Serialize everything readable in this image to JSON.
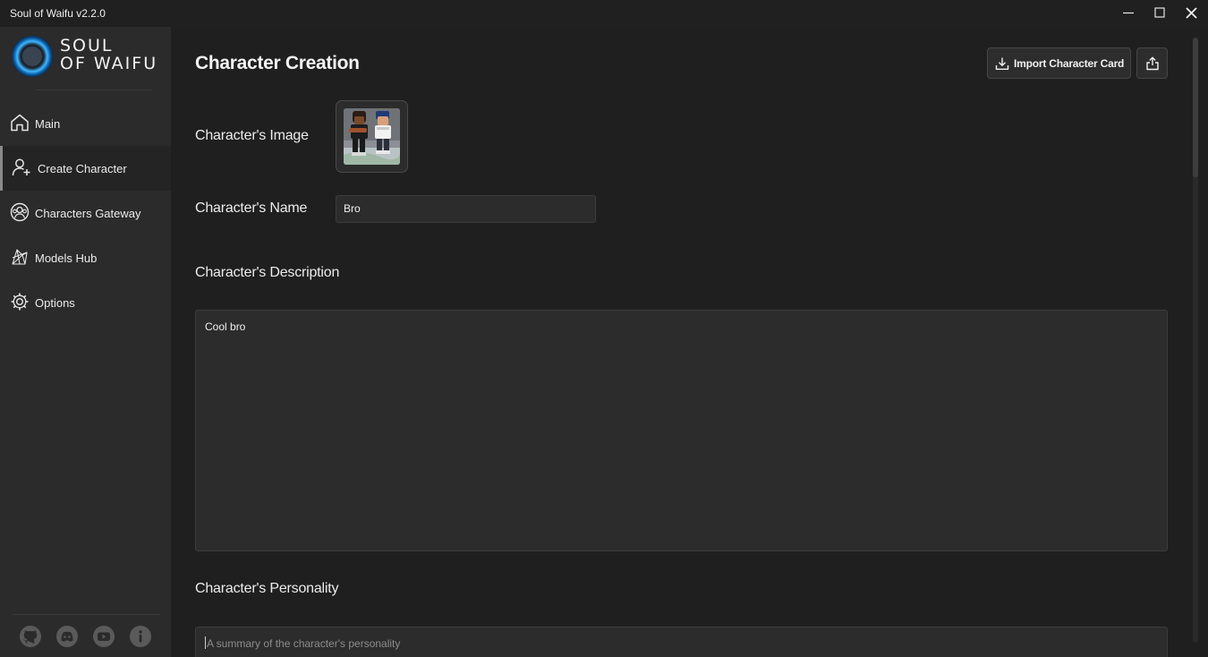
{
  "window": {
    "title": "Soul of Waifu v2.2.0",
    "controls": [
      "minimize-icon",
      "maximize-icon",
      "close-icon"
    ]
  },
  "sidebar": {
    "logo_line1": "SOUL",
    "logo_line2": "OF WAIFU",
    "items": [
      {
        "label": "Main",
        "icon": "home-icon",
        "active": false
      },
      {
        "label": "Create Character",
        "icon": "add-user-icon",
        "active": true
      },
      {
        "label": "Characters Gateway",
        "icon": "users-circle-icon",
        "active": false
      },
      {
        "label": "Models Hub",
        "icon": "network-icon",
        "active": false
      },
      {
        "label": "Options",
        "icon": "gear-icon",
        "active": false
      }
    ],
    "footer_icons": [
      "github-icon",
      "discord-icon",
      "youtube-icon",
      "info-icon"
    ]
  },
  "main": {
    "title": "Character Creation",
    "import_label": "Import Character Card",
    "image_label": "Character's Image",
    "name_label": "Character's Name",
    "name_value": "Bro",
    "description_label": "Character's Description",
    "description_value": "Cool bro",
    "personality_label": "Character's Personality",
    "personality_placeholder": "A summary of the character's personality"
  },
  "colors": {
    "background": "#1f1f1f",
    "sidebar": "#2b2b2b",
    "input": "#2c2c2c",
    "accent_logo": "#3fb7ff"
  }
}
